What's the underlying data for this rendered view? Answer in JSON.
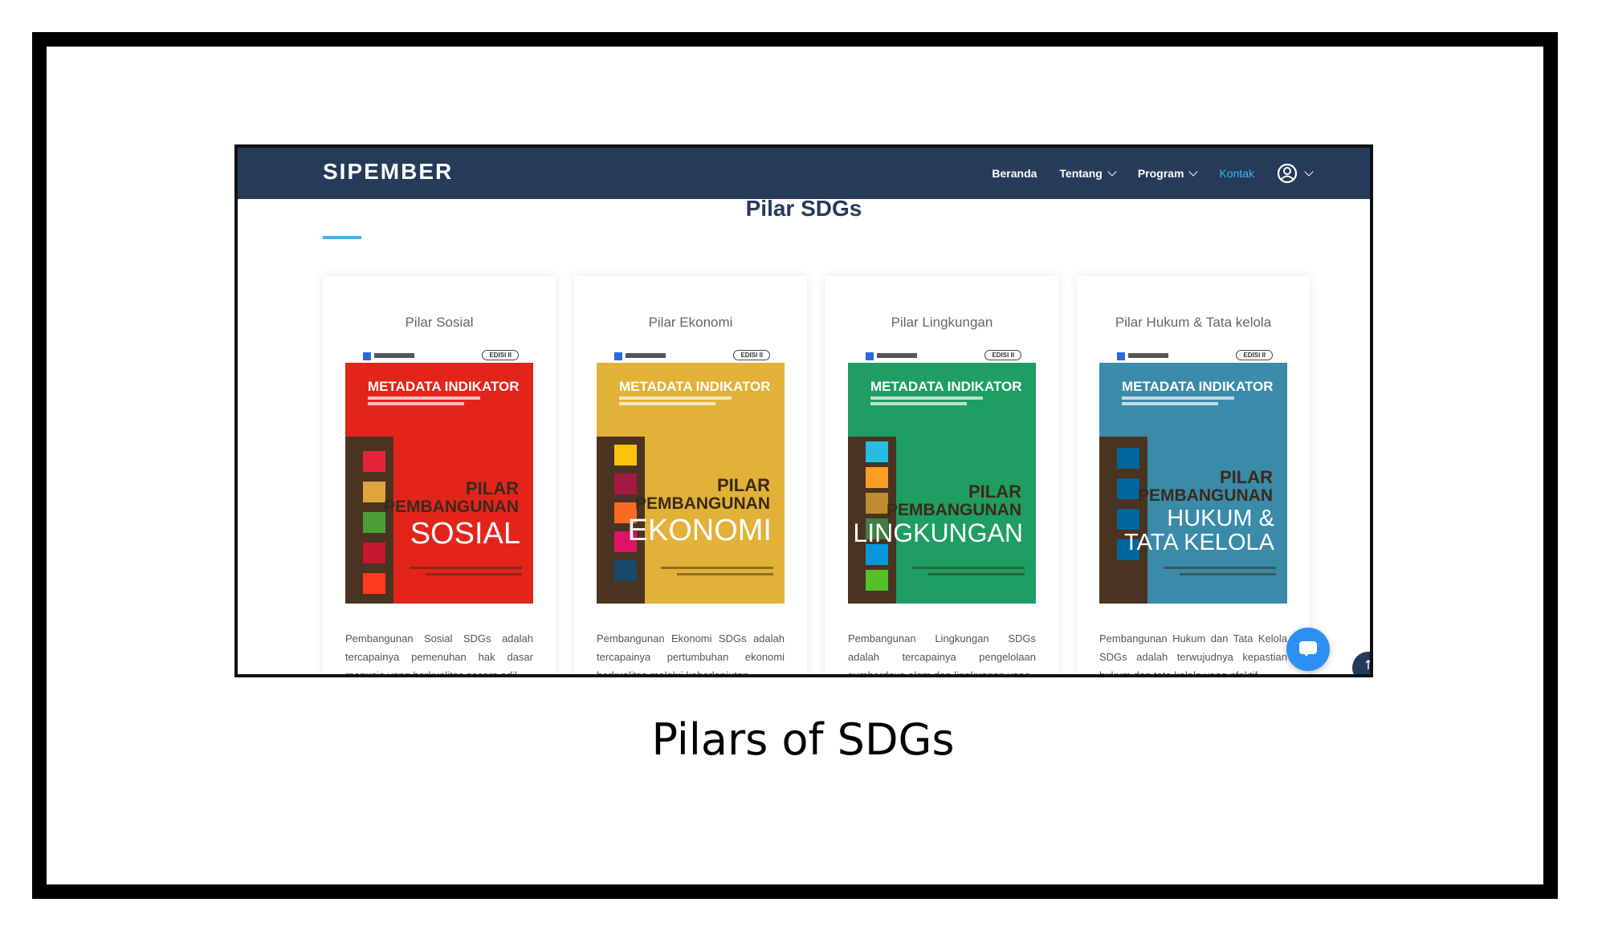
{
  "caption": "Pilars of SDGs",
  "nav": {
    "brand": "SIPEMBER",
    "items": [
      {
        "label": "Beranda"
      },
      {
        "label": "Tentang"
      },
      {
        "label": "Program"
      },
      {
        "label": "Kontak"
      }
    ]
  },
  "section": {
    "title": "Pilar SDGs"
  },
  "cards": [
    {
      "title": "Pilar Sosial",
      "cover": {
        "edisi": "EDISI II",
        "meta": "METADATA INDIKATOR",
        "line1": "PILAR",
        "line2": "PEMBANGUNAN",
        "line3": "SOSIAL",
        "color": "#e3241b"
      },
      "desc": "Pembangunan Sosial SDGs adalah tercapainya pemenuhan hak dasar manusia yang berkualitas secara adil"
    },
    {
      "title": "Pilar Ekonomi",
      "cover": {
        "edisi": "EDISI II",
        "meta": "METADATA INDIKATOR",
        "line1": "PILAR",
        "line2": "PEMBANGUNAN",
        "line3": "EKONOMI",
        "color": "#e2b137"
      },
      "desc": "Pembangunan Ekonomi SDGs adalah tercapainya pertumbuhan ekonomi berkualitas melalui keberlanjutan"
    },
    {
      "title": "Pilar Lingkungan",
      "cover": {
        "edisi": "EDISI II",
        "meta": "METADATA INDIKATOR",
        "line1": "PILAR",
        "line2": "PEMBANGUNAN",
        "line3": "LINGKUNGAN",
        "color": "#1e9e62"
      },
      "desc": "Pembangunan Lingkungan SDGs adalah tercapainya pengelolaan sumberdaya alam dan lingkungan yang"
    },
    {
      "title": "Pilar Hukum & Tata kelola",
      "cover": {
        "edisi": "EDISI II",
        "meta": "METADATA INDIKATOR",
        "line1": "PILAR",
        "line2": "PEMBANGUNAN",
        "line3": "HUKUM &",
        "line4": "TATA KELOLA",
        "color": "#3a8aa9"
      },
      "desc": "Pembangunan Hukum dan Tata Kelola SDGs adalah terwujudnya kepastian hukum dan tata kelola yang efektif"
    }
  ]
}
